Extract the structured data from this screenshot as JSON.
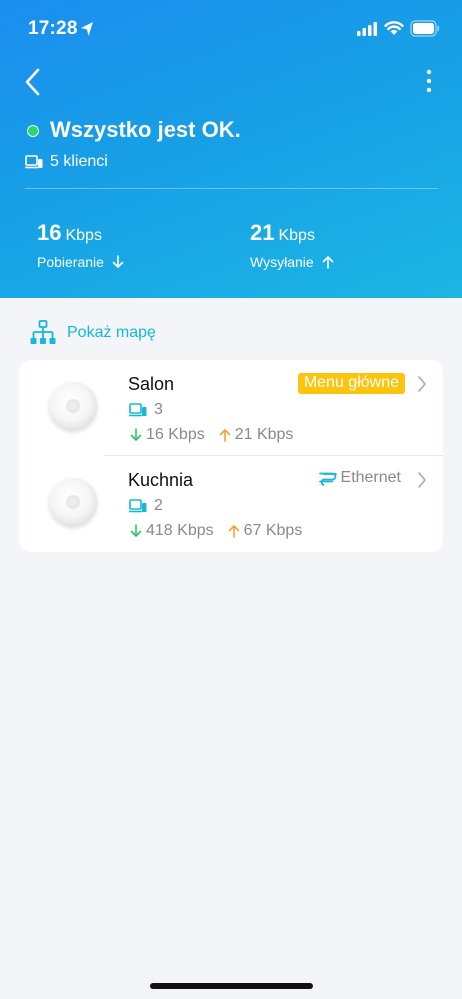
{
  "status_bar": {
    "time": "17:28"
  },
  "header": {
    "status_title": "Wszystko jest OK.",
    "clients_label": "5 klienci",
    "download": {
      "value": "16",
      "unit": "Kbps",
      "caption": "Pobieranie"
    },
    "upload": {
      "value": "21",
      "unit": "Kbps",
      "caption": "Wysyłanie"
    }
  },
  "map_link": {
    "label": "Pokaż mapę"
  },
  "devices": [
    {
      "name": "Salon",
      "badge": "Menu główne",
      "clients": "3",
      "down": "16 Kbps",
      "up": "21 Kbps"
    },
    {
      "name": "Kuchnia",
      "connection": "Ethernet",
      "clients": "2",
      "down": "418 Kbps",
      "up": "67 Kbps"
    }
  ],
  "colors": {
    "header_gradient_start": "#1b8ef0",
    "header_gradient_end": "#1cb6e4",
    "accent_cyan": "#14b8d8",
    "badge_yellow": "#fdc40d",
    "status_green": "#2bd66b",
    "down_arrow_green": "#2cc36b",
    "up_arrow_orange": "#f4a32a"
  },
  "icons": [
    "location-arrow-icon",
    "signal-icon",
    "wifi-icon",
    "battery-icon",
    "back-arrow-icon",
    "more-vertical-icon",
    "laptop-icon",
    "arrow-down-icon",
    "arrow-up-icon",
    "network-map-icon",
    "ethernet-icon",
    "chevron-right-icon"
  ]
}
